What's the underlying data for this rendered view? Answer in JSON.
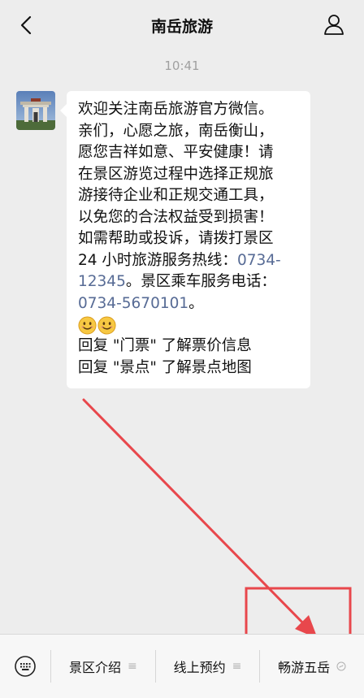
{
  "header": {
    "title": "南岳旅游",
    "back_icon": "chevron-left-icon",
    "profile_icon": "person-icon"
  },
  "chat": {
    "timestamp": "10:41",
    "message": {
      "line1": "欢迎关注南岳旅游官方微信。",
      "line2": "亲们，心愿之旅，南岳衡山，",
      "line3": "愿您吉祥如意、平安健康！请",
      "line4": "在景区游览过程中选择正规旅",
      "line5": "游接待企业和正规交通工具，",
      "line6": "以免您的合法权益受到损害！",
      "line7": "如需帮助或投诉，请拨打景区",
      "line8_text": "24 小时旅游服务热线：",
      "hotline_part1": "0734-",
      "hotline_part2": "12345",
      "line9_text": "。景区乘车服务电话：",
      "bus_phone": "0734-5670101",
      "line10_end": "。",
      "reply1": "回复 \"门票\" 了解票价信息",
      "reply2": "回复 \"景点\" 了解景点地图"
    },
    "emojis": [
      "smile-emoji",
      "smile-emoji"
    ]
  },
  "menu": {
    "keyboard_icon": "keyboard-icon",
    "items": [
      {
        "label": "景区介绍",
        "glyph": "≡"
      },
      {
        "label": "线上预约",
        "glyph": "≡"
      },
      {
        "label": "畅游五岳",
        "glyph": "mini-program-icon"
      }
    ]
  },
  "colors": {
    "background": "#ededed",
    "link": "#576b95",
    "annotation": "#e8474c"
  }
}
